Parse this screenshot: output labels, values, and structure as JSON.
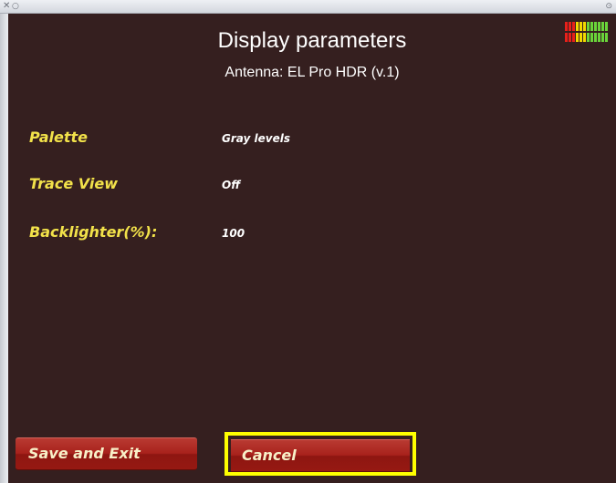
{
  "window": {
    "close_glyph": "✕",
    "minimize_glyph": "○",
    "menu_glyph": "⊙"
  },
  "header": {
    "title": "Display parameters",
    "subtitle": "Antenna: EL Pro HDR (v.1)"
  },
  "signal_meter": {
    "icon": "signal-level-meter-icon",
    "colors": [
      "#e8201a",
      "#e8201a",
      "#e8201a",
      "#f2d800",
      "#f2d800",
      "#f2d800",
      "#6ad43a",
      "#6ad43a",
      "#6ad43a",
      "#6ad43a",
      "#6ad43a",
      "#6ad43a"
    ]
  },
  "params": [
    {
      "label": "Palette",
      "value": "Gray levels"
    },
    {
      "label": "Trace View",
      "value": "Off"
    },
    {
      "label": "Backlighter(%):",
      "value": "100"
    }
  ],
  "buttons": {
    "save_exit": "Save and Exit",
    "cancel": "Cancel"
  },
  "colors": {
    "background": "#351f1f",
    "label": "#f2e24a",
    "button": "#a8221c",
    "focus": "#ffff00"
  }
}
